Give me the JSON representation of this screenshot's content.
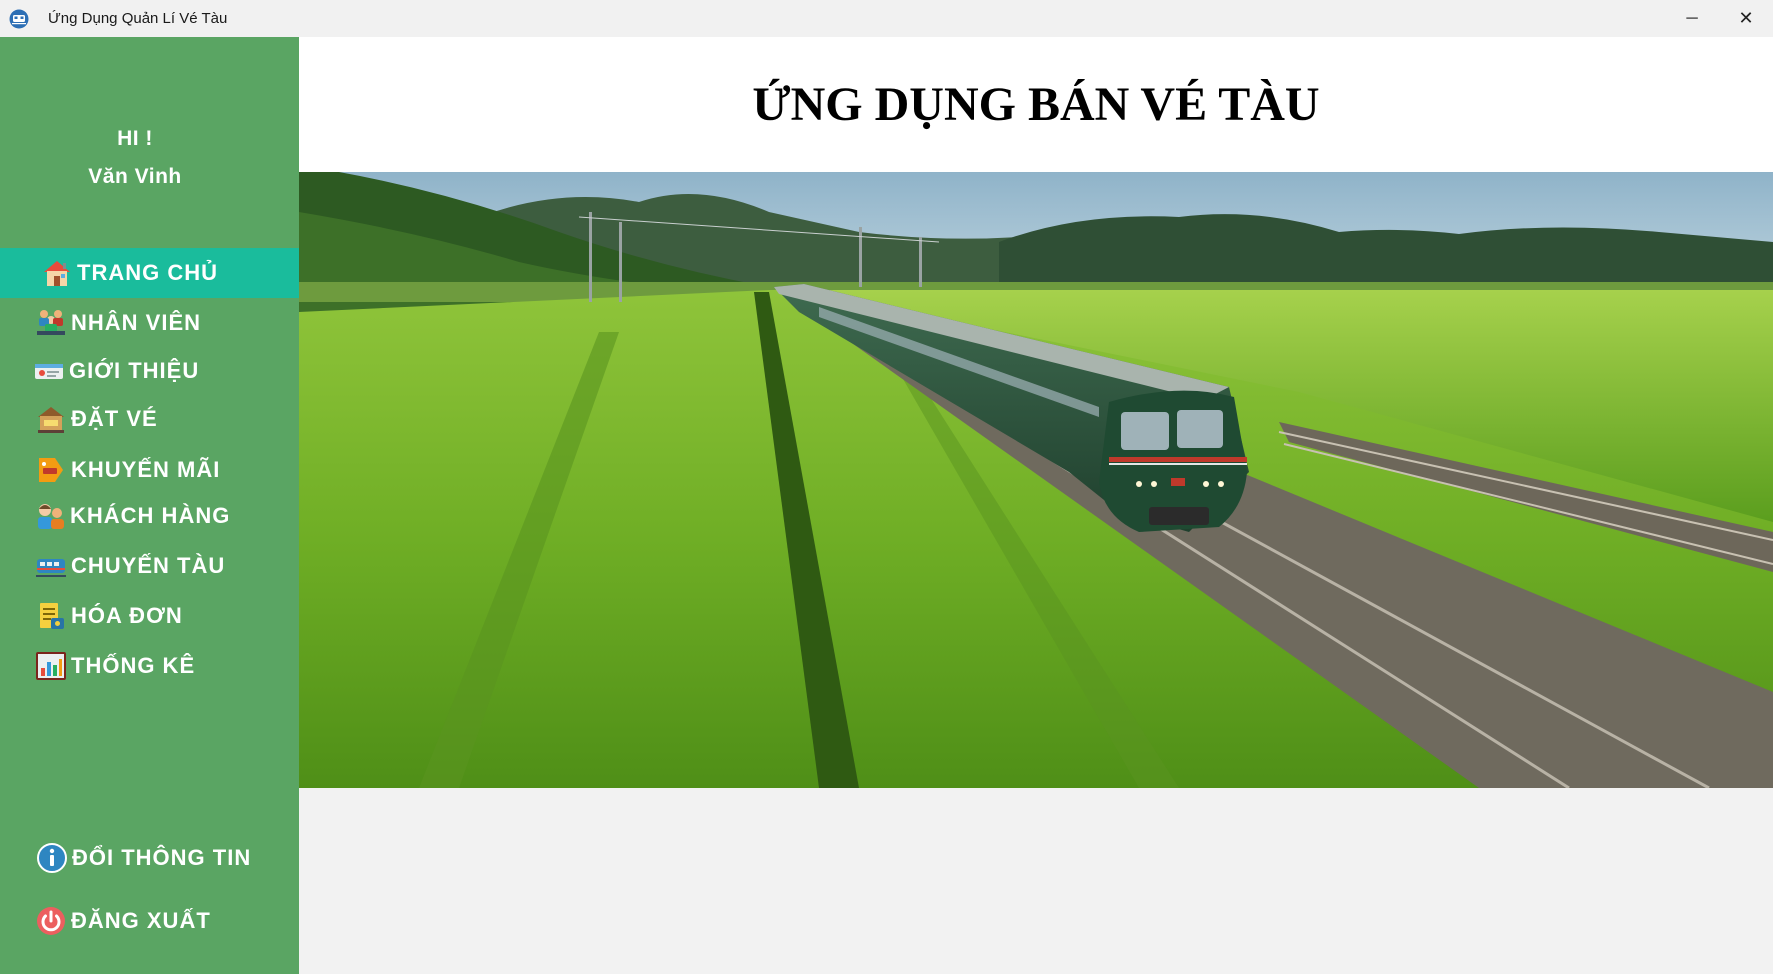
{
  "window": {
    "title": "Ứng Dụng Quản Lí Vé Tàu",
    "minimize_glyph": "─",
    "close_glyph": "✕"
  },
  "sidebar": {
    "greeting": "HI !",
    "user_name": "Văn Vinh",
    "items": [
      {
        "label": "TRANG CHỦ",
        "icon": "home-icon",
        "active": true
      },
      {
        "label": "NHÂN VIÊN",
        "icon": "staff-icon"
      },
      {
        "label": "GIỚI THIỆU",
        "icon": "intro-card-icon"
      },
      {
        "label": "ĐẶT VÉ",
        "icon": "ticket-booking-icon"
      },
      {
        "label": "KHUYẾN MÃI",
        "icon": "sale-tag-icon"
      },
      {
        "label": "KHÁCH HÀNG",
        "icon": "customer-icon"
      },
      {
        "label": "CHUYẾN TÀU",
        "icon": "train-icon"
      },
      {
        "label": "HÓA ĐƠN",
        "icon": "invoice-icon"
      },
      {
        "label": "THỐNG KÊ",
        "icon": "statistics-icon"
      }
    ],
    "bottom_items": [
      {
        "label": "ĐỔI THÔNG TIN",
        "icon": "info-icon"
      },
      {
        "label": "ĐĂNG XUẤT",
        "icon": "power-icon"
      }
    ]
  },
  "main": {
    "title": "ỨNG DỤNG BÁN VÉ TÀU",
    "hero_image": "train-through-rice-fields-photo"
  },
  "colors": {
    "sidebar_bg": "#5aa563",
    "active_item_bg": "#1abc9c",
    "header_bg": "#ffffff",
    "content_bg": "#f2f2f2"
  }
}
